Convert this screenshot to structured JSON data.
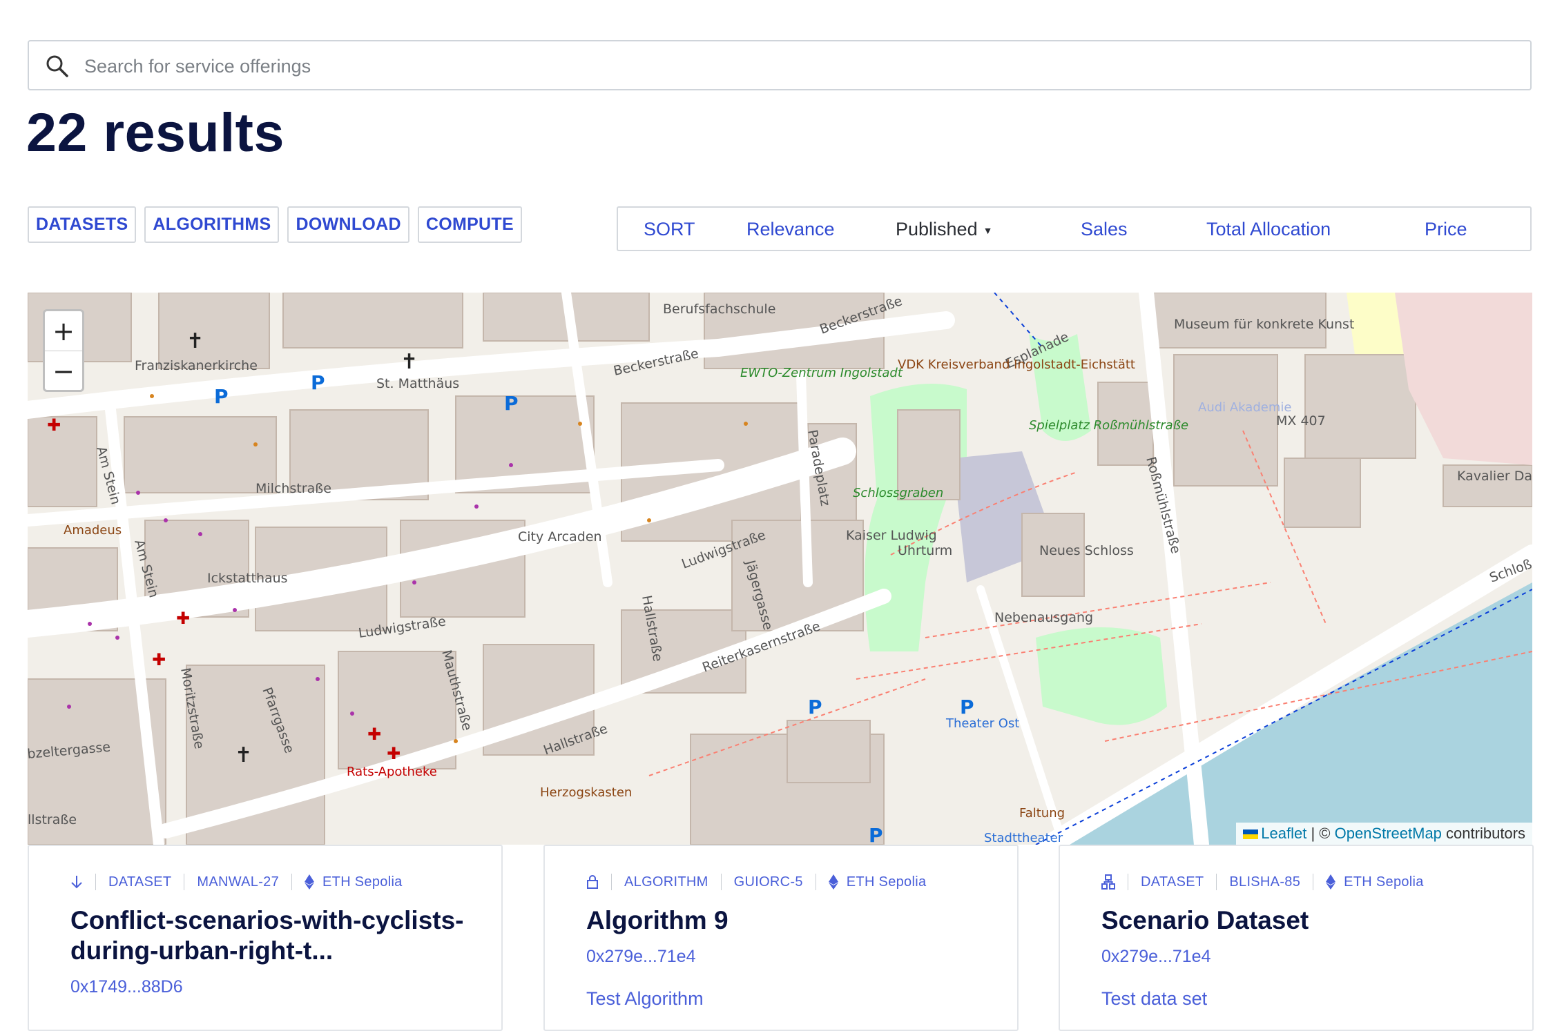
{
  "search": {
    "placeholder": "Search for service offerings"
  },
  "results_label": "22 results",
  "filters": [
    "DATASETS",
    "ALGORITHMS",
    "DOWNLOAD",
    "COMPUTE"
  ],
  "sort": {
    "label": "SORT",
    "options": [
      "Relevance",
      "Published",
      "Sales",
      "Total Allocation",
      "Price"
    ],
    "selected": "Published"
  },
  "map": {
    "zoom_in": "+",
    "zoom_out": "−",
    "attribution": {
      "leaflet": "Leaflet",
      "separator": "| ©",
      "osm": "OpenStreetMap",
      "suffix": "contributors"
    },
    "labels": {
      "berufsfachschule": "Berufsfachschule",
      "beckerstrasse1": "Beckerstraße",
      "beckerstrasse2": "Beckerstraße",
      "franziskanerkirche": "Franziskanerkirche",
      "st_matthaus": "St. Matthäus",
      "ewto": "EWTO-Zentrum Ingolstadt",
      "vdk": "VDK Kreisverband Ingolstadt-Eichstätt",
      "esplanade": "Esplanade",
      "museum": "Museum für konkrete Kunst",
      "mx407": "MX 407",
      "audi": "Audi Akademie",
      "spielplatz": "Spielplatz Roßmühlstraße",
      "rossmuhlstrasse": "Roßmühlstraße",
      "kavalier": "Kavalier Dalwigk",
      "schlossgraben": "Schlossgraben",
      "milchstrasse": "Milchstraße",
      "am_stein1": "Am Stein",
      "am_stein2": "Am Stein",
      "amadeus": "Amadeus",
      "paradeplatz": "Paradeplatz",
      "city_arcaden": "City Arcaden",
      "ludwigstrasse1": "Ludwigstraße",
      "ludwigstrasse2": "Ludwigstraße",
      "kaiser_ludwig": "Kaiser Ludwig",
      "uhrturm": "Uhrturm",
      "neues_schloss": "Neues Schloss",
      "ickstatthaus": "Ickstatthaus",
      "jaegergasse": "Jägergasse",
      "hallstrasse1": "Hallstraße",
      "hallstrasse2": "Hallstraße",
      "reiterkasernstrasse": "Reiterkasernstraße",
      "nebenausgang": "Nebenausgang",
      "moritzstrasse": "Moritzstraße",
      "pfarrgasse": "Pfarrgasse",
      "mauthstrasse": "Mauthstraße",
      "theater_ost": "Theater Ost",
      "rats_apotheke": "Rats-Apotheke",
      "herzogskasten": "Herzogskasten",
      "faltung": "Faltung",
      "stadttheater": "Stadttheater",
      "schloss": "Schloß",
      "zeltergasse": "bzeltergasse",
      "llstrasse": "llstraße"
    }
  },
  "cards": [
    {
      "type": "DATASET",
      "symbol": "MANWAL-27",
      "network": "ETH Sepolia",
      "icon": "download-icon",
      "title": "Conflict-scenarios-with-cyclists-during-urban-right-t...",
      "address": "0x1749...88D6",
      "description": ""
    },
    {
      "type": "ALGORITHM",
      "symbol": "GUIORC-5",
      "network": "ETH Sepolia",
      "icon": "lock-icon",
      "title": "Algorithm 9",
      "address": "0x279e...71e4",
      "description": "Test Algorithm"
    },
    {
      "type": "DATASET",
      "symbol": "BLISHA-85",
      "network": "ETH Sepolia",
      "icon": "compute-icon",
      "title": "Scenario Dataset",
      "address": "0x279e...71e4",
      "description": "Test data set"
    }
  ],
  "colors": {
    "heading": "#0b1440",
    "accent": "#2f49d1",
    "map_road": "#ffffff",
    "map_building": "#d9d0c9",
    "map_park": "#c8facc",
    "map_water": "#aad3df"
  }
}
